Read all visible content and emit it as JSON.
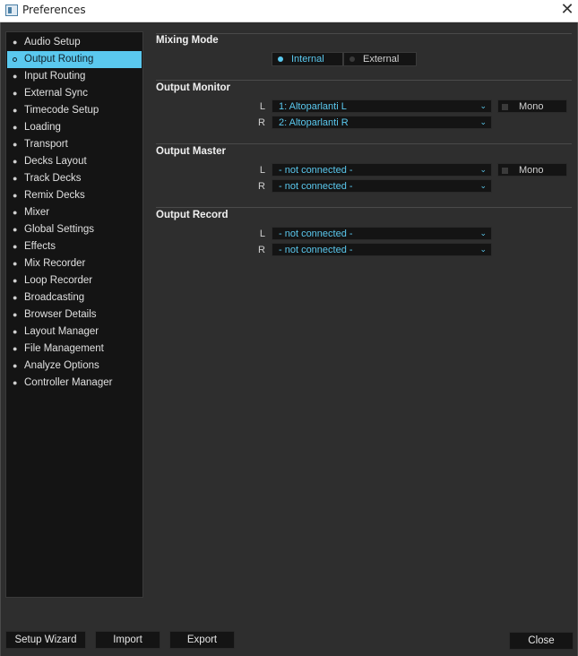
{
  "window": {
    "title": "Preferences",
    "close_glyph": "✕"
  },
  "sidebar": {
    "selected_index": 1,
    "items": [
      {
        "label": "Audio Setup"
      },
      {
        "label": "Output Routing"
      },
      {
        "label": "Input Routing"
      },
      {
        "label": "External Sync"
      },
      {
        "label": "Timecode Setup"
      },
      {
        "label": "Loading"
      },
      {
        "label": "Transport"
      },
      {
        "label": "Decks Layout"
      },
      {
        "label": "Track Decks"
      },
      {
        "label": "Remix Decks"
      },
      {
        "label": "Mixer"
      },
      {
        "label": "Global Settings"
      },
      {
        "label": "Effects"
      },
      {
        "label": "Mix Recorder"
      },
      {
        "label": "Loop Recorder"
      },
      {
        "label": "Broadcasting"
      },
      {
        "label": "Browser Details"
      },
      {
        "label": "Layout Manager"
      },
      {
        "label": "File Management"
      },
      {
        "label": "Analyze Options"
      },
      {
        "label": "Controller Manager"
      }
    ]
  },
  "mixing_mode": {
    "title": "Mixing Mode",
    "internal_label": "Internal",
    "external_label": "External",
    "selected": "Internal"
  },
  "output_monitor": {
    "title": "Output Monitor",
    "left_label": "L",
    "right_label": "R",
    "left_value": "1: Altoparlanti L",
    "right_value": "2: Altoparlanti R",
    "mono_label": "Mono"
  },
  "output_master": {
    "title": "Output Master",
    "left_label": "L",
    "right_label": "R",
    "left_value": "- not connected -",
    "right_value": "- not connected -",
    "mono_label": "Mono"
  },
  "output_record": {
    "title": "Output Record",
    "left_label": "L",
    "right_label": "R",
    "left_value": "- not connected -",
    "right_value": "- not connected -"
  },
  "footer": {
    "setup_wizard": "Setup Wizard",
    "import": "Import",
    "export": "Export",
    "close": "Close"
  },
  "colors": {
    "accent": "#5ac8ee",
    "panel": "#141414",
    "background": "#2e2e2e"
  },
  "icons": {
    "chevron": "chevron-down-icon",
    "app": "preferences-app-icon",
    "close": "close-icon"
  }
}
